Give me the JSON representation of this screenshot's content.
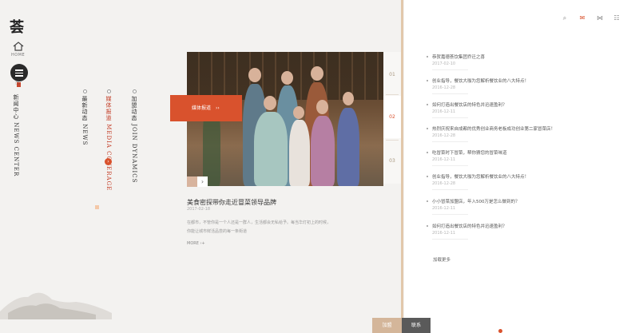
{
  "brand": {
    "logo_char": "荟",
    "home_label": "HOME"
  },
  "nav": {
    "items": [
      {
        "label": "新闻中心 NEWS CENTER"
      },
      {
        "label": "最新动态 NEWS"
      },
      {
        "label": "媒体报道 MEDIA COVERAGE"
      },
      {
        "label": "加盟动态 JOIN DYNAMICS"
      }
    ]
  },
  "carousel": {
    "tag_label": "媒体报道",
    "tag_arrow": "››",
    "pager": [
      "01",
      "02",
      "03"
    ],
    "next_arrow": "›"
  },
  "article": {
    "title": "美食密探带你走近冒菜领导品牌",
    "date": "2017-02-18",
    "desc": "在都市，不管你是一个人还是一群人，生活都会无私给予。每当华灯初上的时候，你能让城市鲜活品尝的每一条街道",
    "more": "MORE ›+"
  },
  "toolbar": {
    "icons": [
      "search-icon",
      "weibo-icon",
      "share-icon",
      "grid-icon"
    ],
    "glyphs": [
      "⌕",
      "✉",
      "⋈",
      "☷"
    ]
  },
  "news": [
    {
      "title": "恭贺嘉德荟饮集团乔迁之喜",
      "date": "2017-02-10"
    },
    {
      "title": "创业指导，餐饮大咖为您解析餐饮业的八大特点！",
      "date": "2016-12-28"
    },
    {
      "title": "如何打造出餐饮店的特色并迅速盈利？",
      "date": "2016-12-11"
    },
    {
      "title": "热烈庆祝来自成都的优秀创业商务老板成功创业第二家冒菜店！",
      "date": "2016-12-28"
    },
    {
      "title": "吃冒菜时下冒菜，帮你猜您的冒菜味道",
      "date": "2016-12-11"
    },
    {
      "title": "创业指导，餐饮大咖为您解析餐饮业的八大特点！",
      "date": "2016-12-28"
    },
    {
      "title": "小小冒菜加盟店，年入500万是怎么做到的？",
      "date": "2016-12-11"
    },
    {
      "title": "如何打造出餐饮店的特色并迅速盈利？",
      "date": "2016-12-11"
    }
  ],
  "load_more": "加载更多",
  "footer": {
    "join": "加盟",
    "contact": "联系"
  },
  "colors": {
    "accent": "#d9522d",
    "tan": "#d4b69a",
    "dark": "#2a2a2a"
  }
}
